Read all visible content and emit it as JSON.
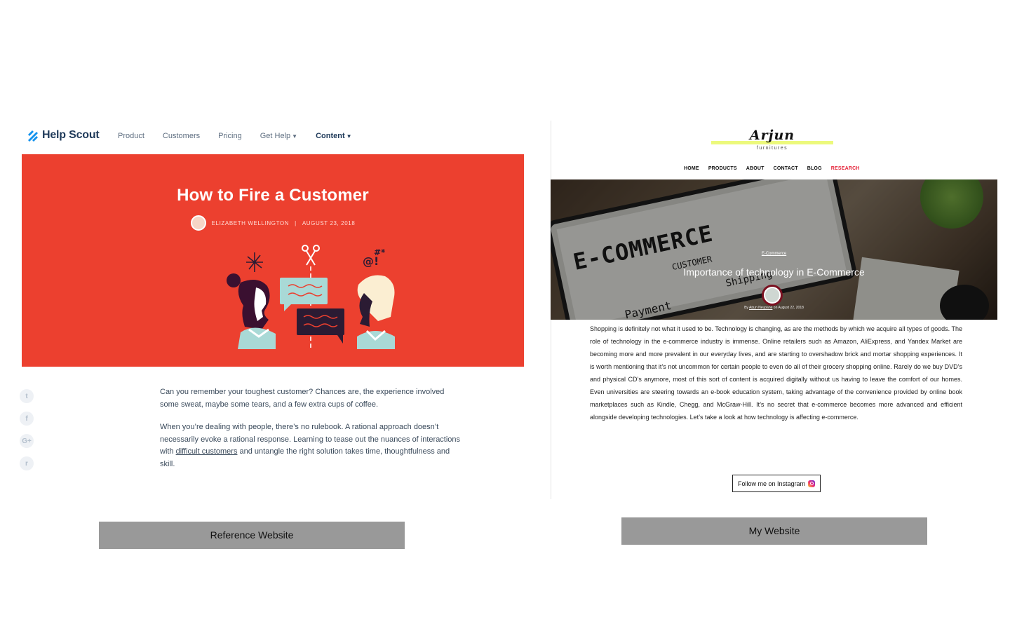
{
  "reference": {
    "logo_text": "Help Scout",
    "nav": [
      {
        "label": "Product"
      },
      {
        "label": "Customers"
      },
      {
        "label": "Pricing"
      },
      {
        "label": "Get Help",
        "dropdown": true
      },
      {
        "label": "Content",
        "dropdown": true,
        "active": true
      }
    ],
    "hero": {
      "title": "How to Fire a Customer",
      "author": "ELIZABETH WELLINGTON",
      "separator": "|",
      "date": "AUGUST 23, 2018",
      "bg_color": "#ec402f"
    },
    "share_icons": [
      "twitter-icon",
      "facebook-icon",
      "google-plus-icon",
      "reddit-icon"
    ],
    "share_glyphs": [
      "t",
      "f",
      "G+",
      "r"
    ],
    "paragraph1": "Can you remember your toughest customer? Chances are, the experience involved some sweat, maybe some tears, and a few extra cups of coffee.",
    "paragraph2_before": "When you’re dealing with people, there’s no rulebook. A rational approach doesn’t necessarily evoke a rational response. Learning to tease out the nuances of interactions with ",
    "paragraph2_link": "difficult customers",
    "paragraph2_after": " and untangle the right solution takes time, thoughtfulness and skill.",
    "caption": "Reference Website"
  },
  "mine": {
    "brand": "Arjun",
    "tagline": "furnitures",
    "nav": [
      {
        "label": "HOME"
      },
      {
        "label": "PRODUCTS"
      },
      {
        "label": "ABOUT"
      },
      {
        "label": "CONTACT"
      },
      {
        "label": "BLOG"
      },
      {
        "label": "RESEARCH",
        "highlight": true
      }
    ],
    "hero": {
      "tablet_word": "E-COMMERCE",
      "tablet_sub": "CUSTOMER",
      "tablet_sub2": "Payment",
      "tablet_sub3": "Shipping",
      "category": "E-Commerce",
      "title": "Importance of technology in E-Commerce",
      "by_prefix": "By ",
      "author": "Arjun Neupane",
      "date_prefix": " on ",
      "date": "August 22, 2018"
    },
    "body": "Shopping is definitely not what it used to be. Technology is changing, as are the methods by which we acquire all types of goods. The role of technology in the e-commerce industry is immense. Online retailers such as Amazon, AliExpress, and Yandex Market are becoming more and more prevalent in our everyday lives, and are starting to overshadow brick and mortar shopping experiences. It is worth mentioning that it’s not uncommon for certain people to even do all of their grocery shopping online. Rarely do we buy DVD’s and physical CD’s anymore, most of this sort of content is acquired digitally without us having to leave the comfort of our homes. Even universities are steering towards an e-book education system, taking advantage of the convenience provided by online book marketplaces such as Kindle, Chegg, and McGraw-Hill. It’s no secret that e-commerce becomes more advanced and efficient alongside developing technologies. Let’s take a look at how technology is affecting e-commerce.",
    "instagram_label": "Follow me on Instagram",
    "caption": "My Website"
  }
}
